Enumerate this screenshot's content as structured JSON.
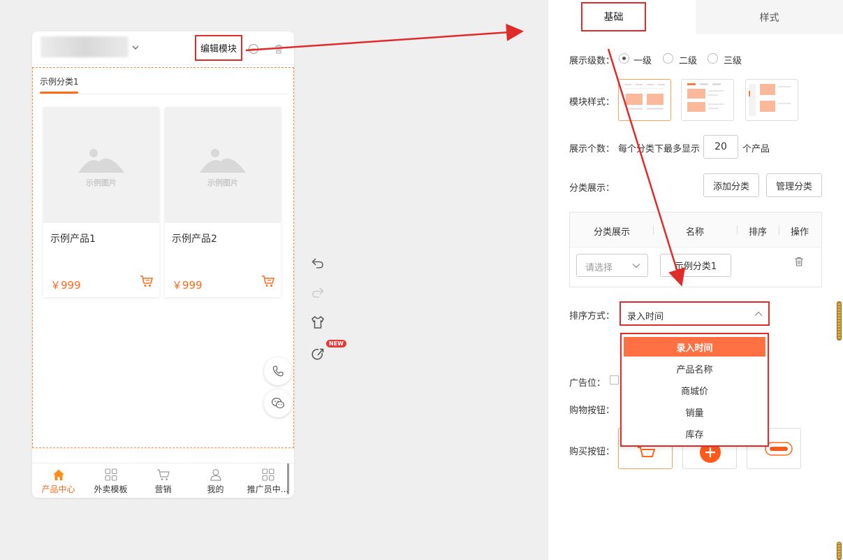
{
  "preview": {
    "edit_module": "编辑模块",
    "tab": "示例分类1",
    "placeholder_caption": "示例图片",
    "products": [
      {
        "name": "示例产品1",
        "price": "￥999"
      },
      {
        "name": "示例产品2",
        "price": "￥999"
      }
    ],
    "nav": [
      {
        "label": "产品中心",
        "icon": "home-icon",
        "active": true
      },
      {
        "label": "外卖模板",
        "icon": "grid-icon",
        "active": false
      },
      {
        "label": "营销",
        "icon": "cart-icon",
        "active": false
      },
      {
        "label": "我的",
        "icon": "user-icon",
        "active": false
      },
      {
        "label": "推广员中...",
        "icon": "grid-icon",
        "active": false
      }
    ]
  },
  "tools": {
    "new_badge": "NEW"
  },
  "panel": {
    "tabs": {
      "basic": "基础",
      "style": "样式"
    },
    "level": {
      "label": "展示级数：",
      "options": [
        "一级",
        "二级",
        "三级"
      ],
      "selected": "一级"
    },
    "module_style": {
      "label": "模块样式："
    },
    "count": {
      "label": "展示个数：",
      "prefix": "每个分类下最多显示",
      "value": "20",
      "suffix": "个产品"
    },
    "category": {
      "label": "分类展示：",
      "add_button": "添加分类",
      "manage_button": "管理分类"
    },
    "table": {
      "headers": [
        "分类展示",
        "名称",
        "排序",
        "操作"
      ],
      "row": {
        "select_placeholder": "请选择",
        "name": "示例分类1"
      }
    },
    "sort": {
      "label": "排序方式：",
      "value": "录入时间",
      "options": [
        "录入时间",
        "产品名称",
        "商城价",
        "销量",
        "库存"
      ],
      "selected": "录入时间"
    },
    "ad_label": "广告位：",
    "shop_button_label": "购物按钮：",
    "buy_button_label": "购买按钮："
  },
  "colors": {
    "accent": "#ff6a1a",
    "annotation": "#e02b2b",
    "selected_option": "#ff7043"
  }
}
